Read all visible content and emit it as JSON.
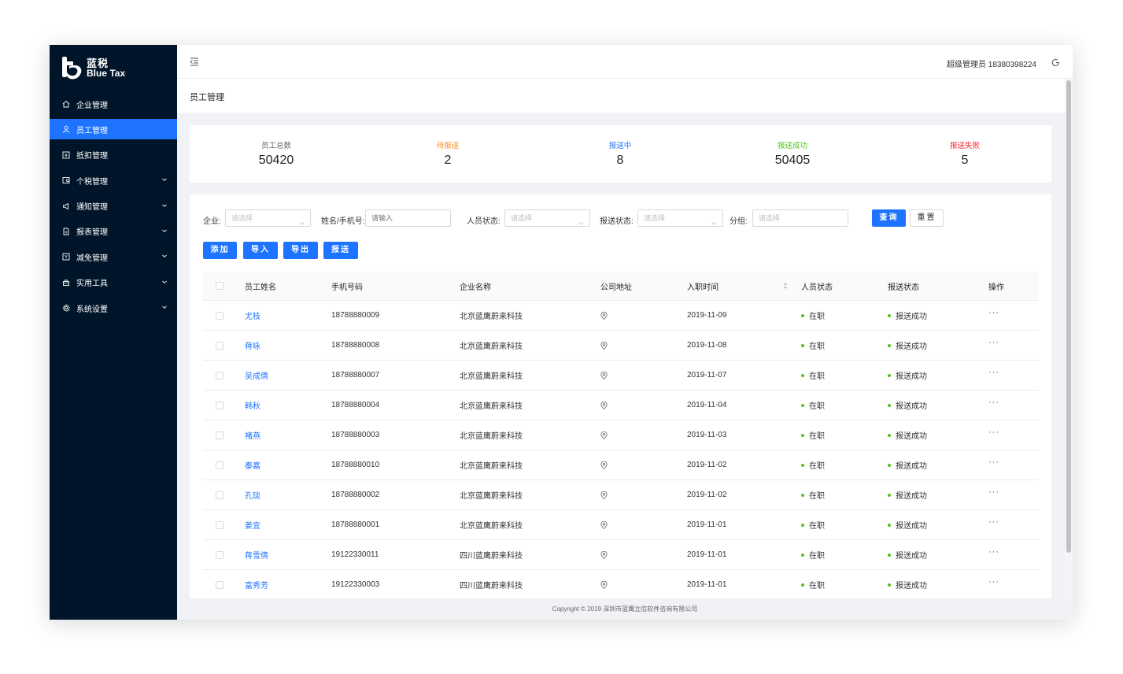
{
  "brand": {
    "name_cn": "蓝税",
    "name_en": "Blue Tax"
  },
  "sidebar": {
    "items": [
      {
        "label": "企业管理",
        "icon": "home-icon",
        "expandable": false,
        "active": false
      },
      {
        "label": "员工管理",
        "icon": "user-icon",
        "expandable": false,
        "active": true
      },
      {
        "label": "抵扣管理",
        "icon": "deduction-icon",
        "expandable": false,
        "active": false
      },
      {
        "label": "个税管理",
        "icon": "wallet-icon",
        "expandable": true,
        "active": false
      },
      {
        "label": "通知管理",
        "icon": "bell-icon",
        "expandable": true,
        "active": false
      },
      {
        "label": "报表管理",
        "icon": "report-icon",
        "expandable": true,
        "active": false
      },
      {
        "label": "减免管理",
        "icon": "discount-icon",
        "expandable": true,
        "active": false
      },
      {
        "label": "实用工具",
        "icon": "tool-icon",
        "expandable": true,
        "active": false
      },
      {
        "label": "系统设置",
        "icon": "gear-icon",
        "expandable": true,
        "active": false
      }
    ]
  },
  "header": {
    "user": "超级管理员 18380398224"
  },
  "page": {
    "title": "员工管理"
  },
  "stats": [
    {
      "label": "员工总数",
      "value": "50420",
      "color": "#666666"
    },
    {
      "label": "待报送",
      "value": "2",
      "color": "#fa8c16"
    },
    {
      "label": "报送中",
      "value": "8",
      "color": "#1e74ff"
    },
    {
      "label": "报送成功",
      "value": "50405",
      "color": "#52c41a"
    },
    {
      "label": "报送失败",
      "value": "5",
      "color": "#f5222d"
    }
  ],
  "filters": {
    "company": {
      "label": "企业:",
      "placeholder": "请选择"
    },
    "name_phone": {
      "label": "姓名/手机号:",
      "placeholder": "请输入"
    },
    "person_status": {
      "label": "人员状态:",
      "placeholder": "请选择"
    },
    "report_status": {
      "label": "报送状态:",
      "placeholder": "请选择"
    },
    "group": {
      "label": "分组:",
      "placeholder": "请选择"
    },
    "query_label": "查询",
    "reset_label": "重置"
  },
  "actions": {
    "add": "添加",
    "import": "导入",
    "export": "导出",
    "report": "报送"
  },
  "table": {
    "columns": [
      "员工姓名",
      "手机号码",
      "企业名称",
      "公司地址",
      "入职时间",
      "人员状态",
      "报送状态",
      "操作"
    ],
    "rows": [
      {
        "name": "尤枝",
        "phone": "18788880009",
        "company": "北京蓝鹰蔚来科技",
        "date": "2019-11-09",
        "person_status": "在职",
        "report_status": "报送成功"
      },
      {
        "name": "蒋咏",
        "phone": "18788880008",
        "company": "北京蓝鹰蔚来科技",
        "date": "2019-11-08",
        "person_status": "在职",
        "report_status": "报送成功"
      },
      {
        "name": "吴成倩",
        "phone": "18788880007",
        "company": "北京蓝鹰蔚来科技",
        "date": "2019-11-07",
        "person_status": "在职",
        "report_status": "报送成功"
      },
      {
        "name": "韩秋",
        "phone": "18788880004",
        "company": "北京蓝鹰蔚来科技",
        "date": "2019-11-04",
        "person_status": "在职",
        "report_status": "报送成功"
      },
      {
        "name": "褚燕",
        "phone": "18788880003",
        "company": "北京蓝鹰蔚来科技",
        "date": "2019-11-03",
        "person_status": "在职",
        "report_status": "报送成功"
      },
      {
        "name": "秦嘉",
        "phone": "18788880010",
        "company": "北京蓝鹰蔚来科技",
        "date": "2019-11-02",
        "person_status": "在职",
        "report_status": "报送成功"
      },
      {
        "name": "孔琰",
        "phone": "18788880002",
        "company": "北京蓝鹰蔚来科技",
        "date": "2019-11-02",
        "person_status": "在职",
        "report_status": "报送成功"
      },
      {
        "name": "姜宜",
        "phone": "18788880001",
        "company": "北京蓝鹰蔚来科技",
        "date": "2019-11-01",
        "person_status": "在职",
        "report_status": "报送成功"
      },
      {
        "name": "蒋雪倩",
        "phone": "19122330011",
        "company": "四川蓝鹰蔚来科技",
        "date": "2019-11-01",
        "person_status": "在职",
        "report_status": "报送成功"
      },
      {
        "name": "富秀芳",
        "phone": "19122330003",
        "company": "四川蓝鹰蔚来科技",
        "date": "2019-11-01",
        "person_status": "在职",
        "report_status": "报送成功"
      }
    ],
    "more_label": "···"
  },
  "footer": {
    "copyright": "Copyright © 2019 深圳市蓝鹰立信软件咨询有限公司"
  },
  "colors": {
    "primary": "#1e74ff",
    "sidebar": "#001529",
    "success": "#52c41a"
  }
}
